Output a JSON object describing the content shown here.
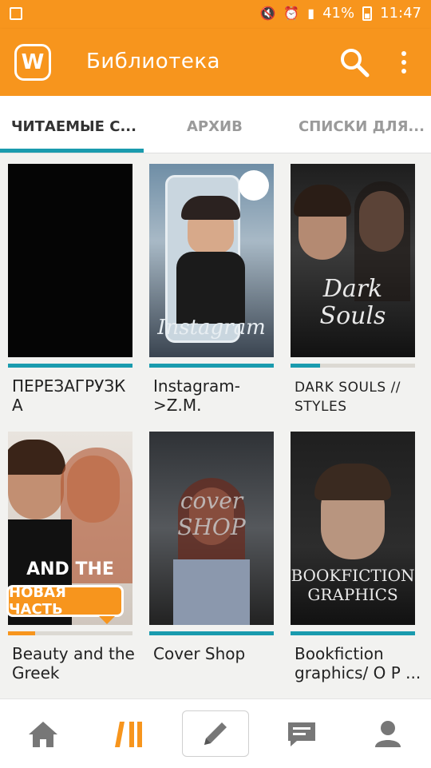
{
  "status": {
    "battery": "41%",
    "time": "11:47"
  },
  "app": {
    "title": "Библиотека",
    "logo": "W"
  },
  "tabs": [
    {
      "label": "ЧИТАЕМЫЕ С..."
    },
    {
      "label": "АРХИВ"
    },
    {
      "label": "СПИСКИ ДЛЯ..."
    }
  ],
  "covers": {
    "instagram": "Instagram",
    "dark_souls": "Dark Souls",
    "beauty": "AND THE",
    "cover_shop": "cover SHOP",
    "bookfiction": "BOOKFICTION GRAPHICS"
  },
  "books": [
    {
      "title_lines": [
        "ПЕРЕЗАГРУЗК",
        "А"
      ],
      "progress": 1.0
    },
    {
      "title_lines": [
        "Instagram-",
        ">Z.M."
      ],
      "progress": 1.0
    },
    {
      "title_lines": [
        "DARK SOULS //",
        "STYLES"
      ],
      "progress": 0.24
    },
    {
      "title_lines": [
        "Beauty and the",
        "Greek"
      ],
      "progress": 0.22,
      "badge": "НОВАЯ ЧАСТЬ"
    },
    {
      "title_lines": [
        "Cover Shop",
        ""
      ],
      "progress": 1.0
    },
    {
      "title_lines": [
        "Bookfiction",
        "graphics/ О Р ..."
      ],
      "progress": 1.0
    }
  ],
  "colors": {
    "accent": "#f7951d",
    "teal": "#1a9bae",
    "track": "#dcd9d3"
  },
  "nav": [
    {
      "icon": "home-icon"
    },
    {
      "icon": "library-icon"
    },
    {
      "icon": "pencil-icon"
    },
    {
      "icon": "messages-icon"
    },
    {
      "icon": "profile-icon"
    }
  ]
}
